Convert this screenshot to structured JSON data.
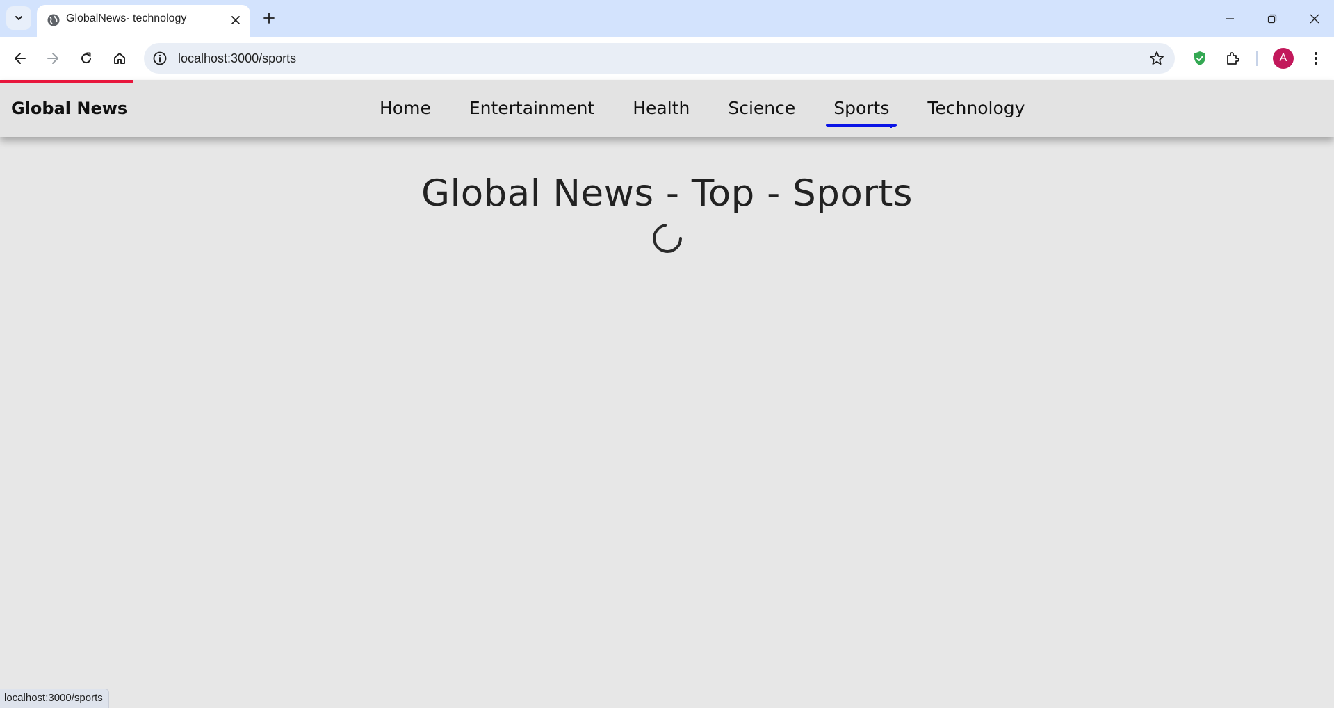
{
  "browser": {
    "tab": {
      "title": "GlobalNews- technology",
      "favicon": "globe-icon"
    },
    "url": "localhost:3000/sports",
    "profile_initial": "A",
    "status_url": "localhost:3000/sports"
  },
  "site": {
    "brand": "Global News",
    "nav": [
      {
        "label": "Home",
        "active": false
      },
      {
        "label": "Entertainment",
        "active": false
      },
      {
        "label": "Health",
        "active": false
      },
      {
        "label": "Science",
        "active": false
      },
      {
        "label": "Sports",
        "active": true
      },
      {
        "label": "Technology",
        "active": false
      }
    ],
    "heading": "Global News - Top - Sports",
    "loading": true
  },
  "colors": {
    "tabstrip": "#d3e3fd",
    "page_background": "#e7e7e7",
    "active_underline": "#0a14e6",
    "loading_bar": "#e8173d",
    "avatar": "#c2185b",
    "extension_shield": "#34a853"
  },
  "icons": {
    "tab_search": "chevron-down-icon",
    "tab_close": "close-icon",
    "new_tab": "plus-icon",
    "minimize": "minimize-icon",
    "restore": "restore-icon",
    "close_window": "close-icon",
    "back": "arrow-left-icon",
    "forward": "arrow-right-icon",
    "reload": "reload-icon",
    "home": "home-icon",
    "site_info": "info-icon",
    "bookmark": "star-icon",
    "extension_shield": "shield-check-icon",
    "extensions": "puzzle-icon",
    "menu": "kebab-menu-icon",
    "spinner": "loading-spinner-icon"
  }
}
